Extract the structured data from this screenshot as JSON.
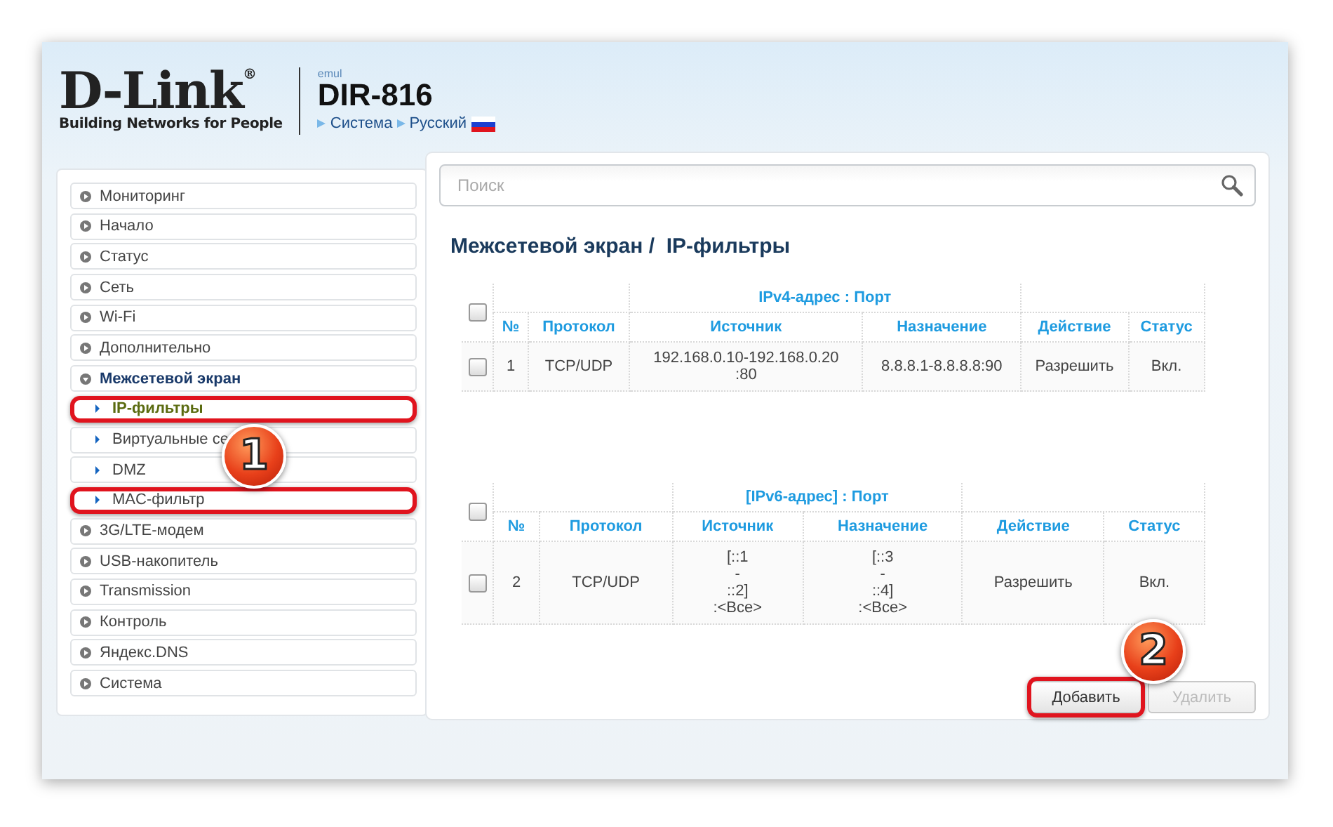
{
  "header": {
    "logo_text": "D-Link",
    "logo_mark": "®",
    "tagline": "Building Networks for People",
    "firmware_label": "emul",
    "model": "DIR-816",
    "breadcrumbs": [
      {
        "label": "Система"
      },
      {
        "label": "Русский"
      }
    ]
  },
  "sidebar": {
    "items": [
      {
        "label": "Мониторинг",
        "kind": "section",
        "expanded": false,
        "selected": false,
        "highlighted": false
      },
      {
        "label": "Начало",
        "kind": "section",
        "expanded": false,
        "selected": false,
        "highlighted": false
      },
      {
        "label": "Статус",
        "kind": "section",
        "expanded": false,
        "selected": false,
        "highlighted": false
      },
      {
        "label": "Сеть",
        "kind": "section",
        "expanded": false,
        "selected": false,
        "highlighted": false
      },
      {
        "label": "Wi-Fi",
        "kind": "section",
        "expanded": false,
        "selected": false,
        "highlighted": false
      },
      {
        "label": "Дополнительно",
        "kind": "section",
        "expanded": false,
        "selected": false,
        "highlighted": false
      },
      {
        "label": "Межсетевой экран",
        "kind": "section",
        "expanded": true,
        "selected": false,
        "highlighted": false
      },
      {
        "label": "IP-фильтры",
        "kind": "subitem",
        "selected": true,
        "highlighted": true
      },
      {
        "label": "Виртуальные се",
        "kind": "subitem",
        "selected": false,
        "highlighted": false,
        "badge": "1"
      },
      {
        "label": "DMZ",
        "kind": "subitem",
        "selected": false,
        "highlighted": false
      },
      {
        "label": "MAC-фильтр",
        "kind": "subitem",
        "selected": false,
        "highlighted": true
      },
      {
        "label": "3G/LTE-модем",
        "kind": "section",
        "expanded": false,
        "selected": false,
        "highlighted": false
      },
      {
        "label": "USB-накопитель",
        "kind": "section",
        "expanded": false,
        "selected": false,
        "highlighted": false
      },
      {
        "label": "Transmission",
        "kind": "section",
        "expanded": false,
        "selected": false,
        "highlighted": false
      },
      {
        "label": "Контроль",
        "kind": "section",
        "expanded": false,
        "selected": false,
        "highlighted": false
      },
      {
        "label": "Яндекс.DNS",
        "kind": "section",
        "expanded": false,
        "selected": false,
        "highlighted": false
      },
      {
        "label": "Система",
        "kind": "section",
        "expanded": false,
        "selected": false,
        "highlighted": false
      }
    ]
  },
  "search": {
    "placeholder": "Поиск"
  },
  "page_title": "Межсетевой экран /  IP-фильтры",
  "tables": [
    {
      "group_header": "IPv4-адрес : Порт",
      "all_checked": false,
      "columns": [
        "№",
        "Протокол",
        "Источник",
        "Назначение",
        "Действие",
        "Статус"
      ],
      "rows": [
        {
          "checked": false,
          "cells": [
            "1",
            "TCP/UDP",
            "192.168.0.10-192.168.0.20\n:80",
            "8.8.8.1-8.8.8.8:90",
            "Разрешить",
            "Вкл."
          ]
        }
      ]
    },
    {
      "group_header": "[IPv6-адрес] : Порт",
      "all_checked": false,
      "columns": [
        "№",
        "Протокол",
        "Источник",
        "Назначение",
        "Действие",
        "Статус"
      ],
      "rows": [
        {
          "checked": false,
          "cells": [
            "2",
            "TCP/UDP",
            "[::1\n-\n::2]\n:<Все>",
            "[::3\n-\n::4]\n:<Все>",
            "Разрешить",
            "Вкл."
          ]
        }
      ]
    }
  ],
  "buttons": [
    {
      "label": "Добавить",
      "disabled": false,
      "highlighted": true,
      "badge": "2"
    },
    {
      "label": "Удалить",
      "disabled": true,
      "highlighted": false
    }
  ]
}
